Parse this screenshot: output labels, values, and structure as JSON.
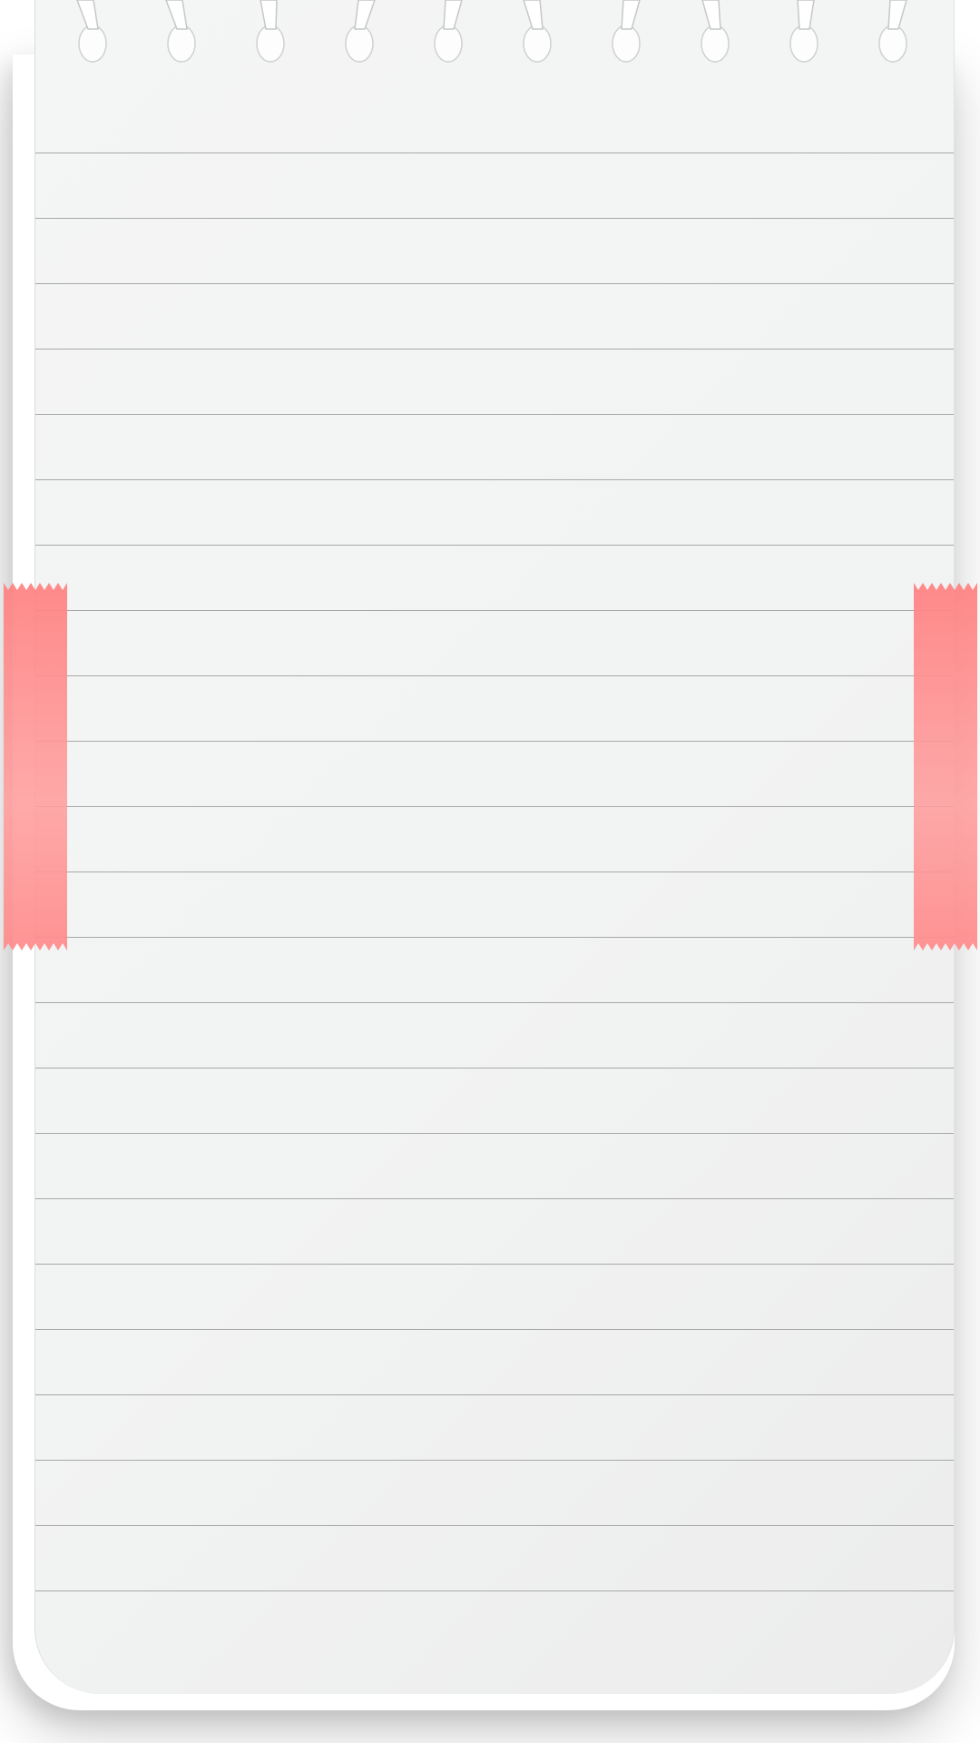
{
  "notepad": {
    "paper_color": "#f2f3f3",
    "rule_color": "#a7a9a9",
    "ruled_line_count": 23,
    "spiral_ring_count": 10
  },
  "tape": {
    "color": "#ff8a8a",
    "pieces": [
      "left",
      "right"
    ]
  }
}
